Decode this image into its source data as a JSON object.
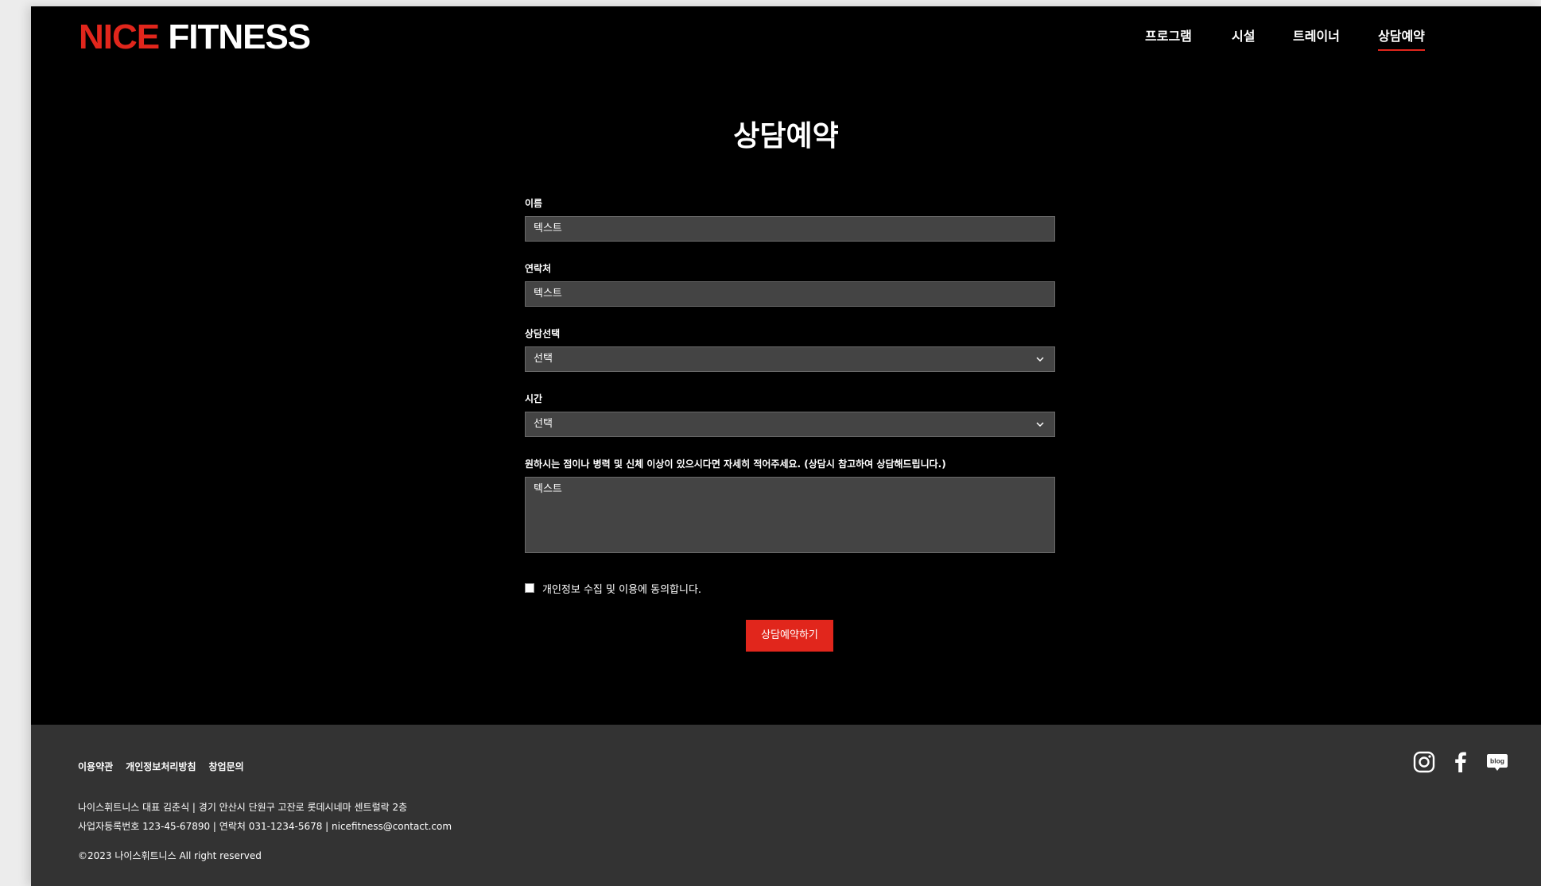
{
  "brand": {
    "part1": "NICE",
    "part2": "FITNESS",
    "accent_color": "#e1261c"
  },
  "nav": {
    "items": [
      {
        "label": "프로그램"
      },
      {
        "label": "시설"
      },
      {
        "label": "트레이너"
      },
      {
        "label": "상담예약",
        "active": true
      }
    ]
  },
  "page": {
    "title": "상담예약"
  },
  "form": {
    "name": {
      "label": "이름",
      "value": "텍스트"
    },
    "contact": {
      "label": "연락처",
      "value": "텍스트"
    },
    "consult_type": {
      "label": "상담선택",
      "value": "선택"
    },
    "time": {
      "label": "시간",
      "value": "선택"
    },
    "notes": {
      "label": "원하시는 점이나 병력 및 신체 이상이 있으시다면 자세히 적어주세요. (상담시 참고하여 상담해드립니다.)",
      "value": "텍스트"
    },
    "agree": {
      "label": "개인정보 수집 및 이용에 동의합니다.",
      "checked": false
    },
    "submit_label": "상담예약하기"
  },
  "footer": {
    "links": [
      {
        "label": "이용약관"
      },
      {
        "label": "개인정보처리방침"
      },
      {
        "label": "창업문의"
      }
    ],
    "info_line1": "나이스휘트니스 대표 김춘식  |  경기 안산시 단원구 고잔로 롯데시네마 센트럴락 2층",
    "info_line2": "사업자등록번호 123-45-67890  |  연락처 031-1234-5678  |  nicefitness@contact.com",
    "copyright": "©2023 나이스휘트니스 All right reserved",
    "social": [
      {
        "icon": "instagram-icon"
      },
      {
        "icon": "facebook-icon"
      },
      {
        "icon": "blog-icon",
        "text": "blog"
      }
    ]
  }
}
